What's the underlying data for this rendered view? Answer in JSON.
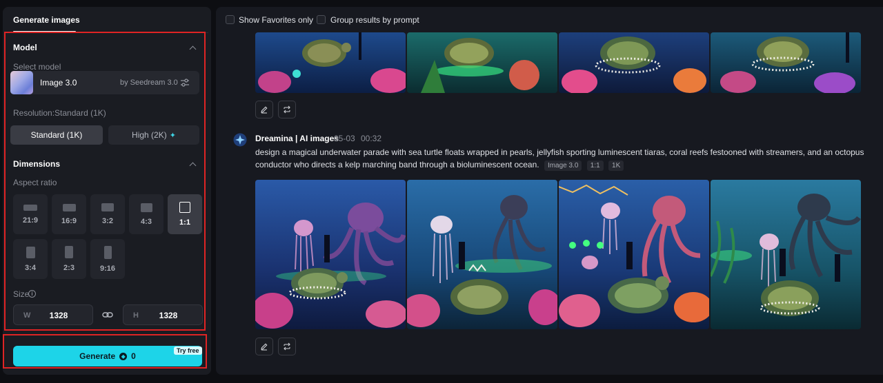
{
  "sidebar": {
    "tab": "Generate images",
    "model": {
      "section_title": "Model",
      "select_label": "Select model",
      "name": "Image 3.0",
      "provider": "by Seedream 3.0",
      "resolution_label": "Resolution:Standard (1K)",
      "resolution_options": [
        "Standard (1K)",
        "High (2K)"
      ],
      "resolution_selected": "Standard (1K)"
    },
    "dimensions": {
      "section_title": "Dimensions",
      "aspect_label": "Aspect ratio",
      "ratios": [
        "21:9",
        "16:9",
        "3:2",
        "4:3",
        "1:1",
        "3:4",
        "2:3",
        "9:16"
      ],
      "selected_ratio": "1:1",
      "size_label": "Size",
      "width_prefix": "W",
      "width": "1328",
      "height_prefix": "H",
      "height": "1328"
    },
    "generate": {
      "label": "Generate",
      "credits": "0",
      "badge": "Try free"
    }
  },
  "toolbar": {
    "favorites_label": "Show Favorites only",
    "group_label": "Group results by prompt"
  },
  "results": {
    "author": "Dreamina | AI images",
    "date": "05-03",
    "time": "00:32",
    "prompt": "design a magical underwater parade with sea turtle floats wrapped in pearls, jellyfish sporting luminescent tiaras, coral reefs festooned with streamers, and an octopus conductor who directs a kelp marching band through a bioluminescent ocean.",
    "tags": [
      "Image 3.0",
      "1:1",
      "1K"
    ]
  },
  "colors": {
    "accent": "#1dd4e8",
    "highlight_outline": "#e02424",
    "panel_bg": "#1a1c22",
    "content_bg": "#171920"
  },
  "icons": {
    "collapse": "chevron-up-icon",
    "settings": "sliders-icon",
    "link": "link-icon",
    "info": "info-icon",
    "edit": "pencil-icon",
    "regenerate": "repeat-icon"
  }
}
